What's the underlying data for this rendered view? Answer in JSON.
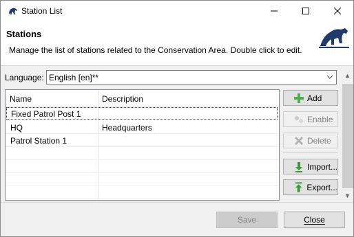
{
  "window": {
    "title": "Station List"
  },
  "header": {
    "title": "Stations",
    "description": "Manage the list of stations related to the Conservation Area.  Double click to edit."
  },
  "language": {
    "label": "Language:",
    "value": "English [en]**"
  },
  "table": {
    "columns": [
      "Name",
      "Description"
    ],
    "rows": [
      {
        "name": "Fixed Patrol Post 1",
        "description": ""
      },
      {
        "name": "HQ",
        "description": "Headquarters"
      },
      {
        "name": "Patrol Station 1",
        "description": ""
      }
    ]
  },
  "buttons": {
    "add": "Add",
    "enable": "Enable",
    "delete": "Delete",
    "import": "Import...",
    "export": "Export..."
  },
  "footer": {
    "save": "Save",
    "close": "Close"
  },
  "colors": {
    "add": "#4caf50",
    "delete": "#b0b0b0",
    "import": "#3a9a3a",
    "logo": "#1f3a6b"
  }
}
